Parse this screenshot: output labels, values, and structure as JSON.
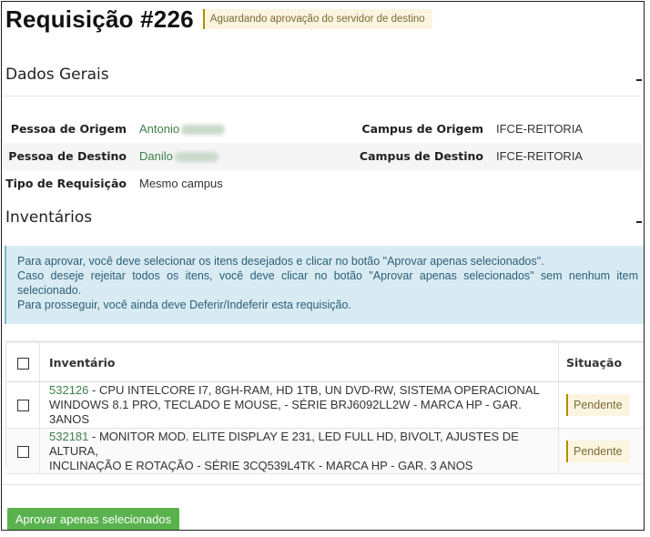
{
  "header": {
    "title": "Requisição #226",
    "status_badge": "Aguardando aprovação do servidor de destino"
  },
  "dados_gerais": {
    "section_title": "Dados Gerais",
    "pessoa_origem_label": "Pessoa de Origem",
    "pessoa_origem_value": "Antonio",
    "pessoa_destino_label": "Pessoa de Destino",
    "pessoa_destino_value": "Danilo",
    "tipo_requisicao_label": "Tipo de Requisição",
    "tipo_requisicao_value": "Mesmo campus",
    "campus_origem_label": "Campus de Origem",
    "campus_origem_value": "IFCE-REITORIA",
    "campus_destino_label": "Campus de Destino",
    "campus_destino_value": "IFCE-REITORIA"
  },
  "inventarios": {
    "section_title": "Inventários",
    "alert_lines": [
      "Para aprovar, você deve selecionar os itens desejados e clicar no botão \"Aprovar apenas selecionados\".",
      "Caso deseje rejeitar todos os itens, você deve clicar no botão \"Aprovar apenas selecionados\" sem nenhum item selecionado.",
      "Para prosseguir, você ainda deve Deferir/Indeferir esta requisição."
    ],
    "table": {
      "col_inventario": "Inventário",
      "col_situacao": "Situação",
      "rows": [
        {
          "numero": "532126",
          "descricao_l1": " - CPU INTELCORE I7, 8GH-RAM, HD 1TB, UN DVD-RW, SISTEMA OPERACIONAL",
          "descricao_l2": "WINDOWS 8.1 PRO, TECLADO E MOUSE, - SÉRIE BRJ6092LL2W - MARCA HP - GAR. 3ANOS",
          "situacao": "Pendente"
        },
        {
          "numero": "532181",
          "descricao_l1": " - MONITOR MOD. ELITE DISPLAY E 231, LED FULL HD, BIVOLT, AJUSTES DE ALTURA,",
          "descricao_l2": "INCLINAÇÃO E ROTAÇÃO - SÉRIE 3CQ539L4TK - MARCA HP - GAR. 3 ANOS",
          "situacao": "Pendente"
        }
      ]
    }
  },
  "actions": {
    "approve_selected_label": "Aprovar apenas selecionados"
  },
  "colors": {
    "link_green": "#3f7f4a",
    "button_green": "#59b24d",
    "alert_bg": "#d8ebf2",
    "badge_bg": "#fbf5e0"
  }
}
